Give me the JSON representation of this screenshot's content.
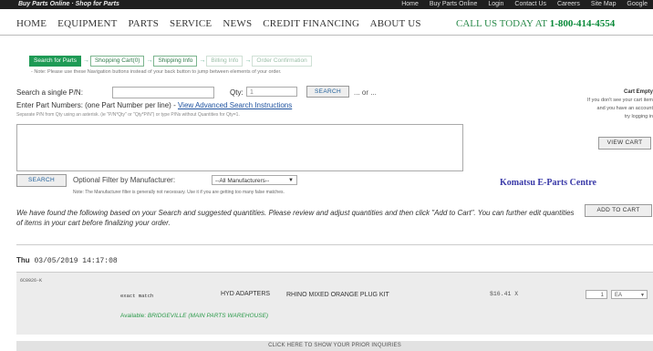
{
  "topbar": {
    "brand": "Buy Parts Online · Shop for Parts",
    "links": [
      "Home",
      "Buy Parts Online",
      "Login",
      "Contact Us",
      "Careers",
      "Site Map",
      "Google"
    ]
  },
  "nav": {
    "items": [
      "HOME",
      "EQUIPMENT",
      "PARTS",
      "SERVICE",
      "NEWS",
      "CREDIT FINANCING",
      "ABOUT US"
    ],
    "call_text": "CALL US TODAY AT",
    "phone": "1-800-414-4554"
  },
  "steps": {
    "items": [
      "Search for Parts",
      "Shopping Cart(0)",
      "Shipping Info",
      "Billing Info",
      "Order Confirmation"
    ],
    "note": "- Note: Please use these Navigation buttons instead of your back button to jump between elements of your order."
  },
  "search": {
    "single_label": "Search a single P/N:",
    "qty_label": "Qty:",
    "qty_value": "1",
    "button_label": "SEARCH",
    "or_text": "... or ...",
    "enter_label": "Enter Part Numbers: (one Part Number per line) -",
    "instructions_link": "View Advanced Search Instructions",
    "separate_note": "Separate P/N from Qty using an asterisk. (ie \"P/N*Qty\" or \"Qty*P/N\") or type P/Ns without Quantities for Qty=1.",
    "search_button2": "SEARCH",
    "filter_label": "Optional Filter by Manufacturer:",
    "filter_value": "--All Manufacturers--",
    "filter_note": "Note: The Manufacturer filter is generally not necessary. Use it if you are getting too many false matches."
  },
  "cart": {
    "title": "Cart Empty",
    "lines": [
      "If you don't see your cart item",
      "and you have an account",
      "try logging in"
    ],
    "view_button": "VIEW CART"
  },
  "komatsu_label": "Komatsu E-Parts Centre",
  "found": {
    "text": "We have found the following based on your Search and suggested quantities. Please review and adjust quantities and then click \"Add to Cart\". You can further edit quantities of items in your cart before finalizing your order.",
    "add_button": "ADD TO CART"
  },
  "datetime": {
    "label": "Thu",
    "value": "03/05/2019 14:17:08"
  },
  "result": {
    "code": "6C0926-K",
    "match": "exact match",
    "category": "HYD ADAPTERS",
    "description": "RHINO MIXED ORANGE PLUG KIT",
    "available_label": "Available:",
    "available_location": "BRIDGEVILLE (MAIN PARTS WAREHOUSE)",
    "price": "$16.41 X",
    "qty": "1",
    "uom": "EA"
  },
  "prior_link": "CLICK HERE TO SHOW YOUR PRIOR INQUIRIES",
  "colors": {
    "accent_green": "#1e9a55",
    "link_blue": "#2154a0",
    "komatsu_blue": "#3a3aa8"
  }
}
